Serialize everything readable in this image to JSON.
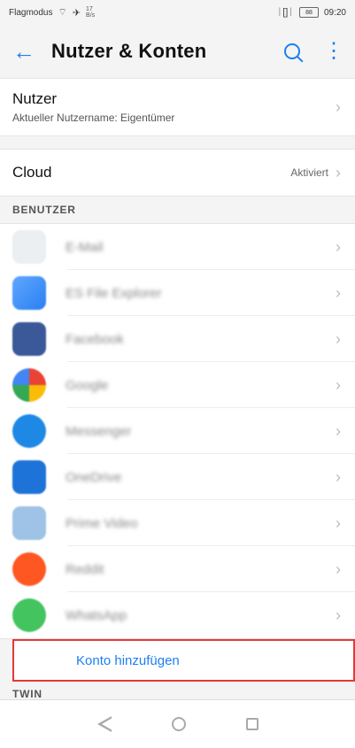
{
  "status_bar": {
    "carrier": "Flagmodus",
    "mini_speed_top": "17",
    "mini_speed_bottom": "B/s",
    "signal": "ᛁ[]ᛁ",
    "battery": "88",
    "time": "09:20"
  },
  "header": {
    "title": "Nutzer & Konten"
  },
  "main": {
    "user": {
      "title": "Nutzer",
      "subtitle": "Aktueller Nutzername: Eigentümer"
    },
    "cloud": {
      "title": "Cloud",
      "status": "Aktiviert"
    },
    "sections": {
      "benutzer": "BENUTZER",
      "twin": "TWIN"
    },
    "accounts": [
      {
        "name": "E-Mail",
        "color": "#eceff1"
      },
      {
        "name": "ES File Explorer",
        "color": "#4c8df6"
      },
      {
        "name": "Facebook",
        "color": "#3b5998"
      },
      {
        "name": "Google",
        "color": "#ffffff"
      },
      {
        "name": "Messenger",
        "color": "#1e88e5"
      },
      {
        "name": "OneDrive",
        "color": "#1e73d8"
      },
      {
        "name": "Prime Video",
        "color": "#9ec3e6"
      },
      {
        "name": "Reddit",
        "color": "#ff5722"
      },
      {
        "name": "WhatsApp",
        "color": "#43c45f"
      }
    ],
    "add_account": "Konto hinzufügen"
  }
}
